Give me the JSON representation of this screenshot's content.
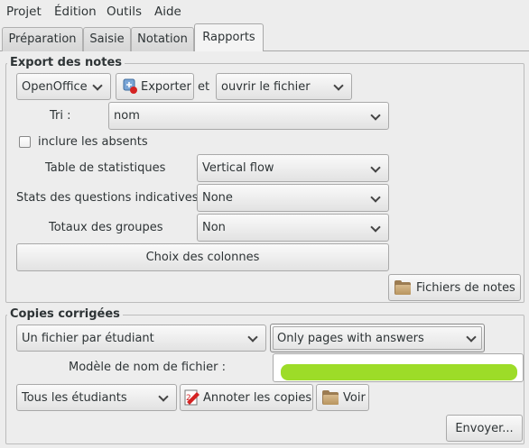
{
  "menu": [
    "Projet",
    "Édition",
    "Outils",
    "Aide"
  ],
  "tabs": [
    "Préparation",
    "Saisie",
    "Notation",
    "Rapports"
  ],
  "export": {
    "title": "Export des notes",
    "format_value": "OpenOffice",
    "export_button": "Exporter",
    "and_label": "et",
    "open_value": "ouvrir le fichier",
    "sort_label": "Tri :",
    "sort_value": "nom",
    "include_absent_label": "inclure les absents",
    "stats_table_label": "Table de statistiques",
    "stats_table_value": "Vertical flow",
    "indicative_label": "Stats des questions indicatives",
    "indicative_value": "None",
    "group_totals_label": "Totaux des groupes",
    "group_totals_value": "Non",
    "columns_button": "Choix des colonnes",
    "grade_files_button": "Fichiers de notes"
  },
  "copies": {
    "title": "Copies corrigées",
    "file_mode_value": "Un fichier par étudiant",
    "pages_value": "Only pages with answers",
    "filename_model_label": "Modèle de nom de fichier :",
    "students_value": "Tous les étudiants",
    "annotate_button": "Annoter les copies",
    "view_button": "Voir",
    "send_button": "Envoyer..."
  },
  "colors": {
    "redaction": "#9ddc28",
    "folder": "#b8955f"
  }
}
